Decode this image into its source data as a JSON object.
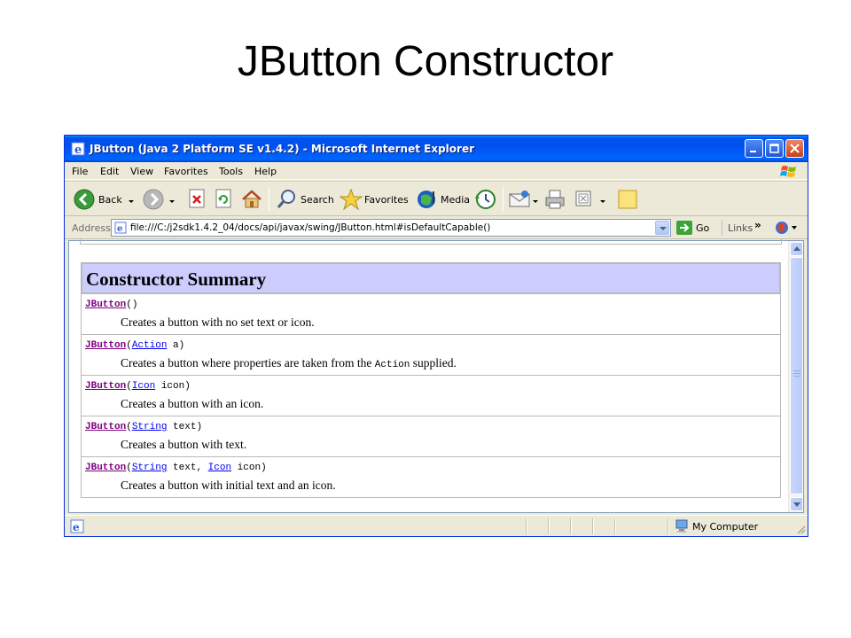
{
  "slide": {
    "title": "JButton Constructor"
  },
  "window": {
    "title": "JButton (Java 2 Platform SE v1.4.2) - Microsoft Internet Explorer"
  },
  "menu": [
    "File",
    "Edit",
    "View",
    "Favorites",
    "Tools",
    "Help"
  ],
  "toolbar": {
    "back_label": "Back",
    "search_label": "Search",
    "favorites_label": "Favorites",
    "media_label": "Media"
  },
  "address": {
    "label": "Address",
    "url": "file:///C:/j2sdk1.4.2_04/docs/api/javax/swing/JButton.html#isDefaultCapable()",
    "go_label": "Go",
    "links_label": "Links",
    "links_chevron": "»"
  },
  "summary": {
    "header": "Constructor Summary",
    "rows": [
      {
        "sig": [
          {
            "text": "JButton",
            "kind": "method"
          },
          {
            "text": "()",
            "kind": "plain"
          }
        ],
        "desc": [
          {
            "text": "Creates a button with no set text or icon.",
            "kind": "text"
          }
        ]
      },
      {
        "sig": [
          {
            "text": "JButton",
            "kind": "method"
          },
          {
            "text": "(",
            "kind": "plain"
          },
          {
            "text": "Action",
            "kind": "type"
          },
          {
            "text": " a)",
            "kind": "plain"
          }
        ],
        "desc": [
          {
            "text": "Creates a button where properties are taken from the ",
            "kind": "text"
          },
          {
            "text": "Action",
            "kind": "code"
          },
          {
            "text": " supplied.",
            "kind": "text"
          }
        ]
      },
      {
        "sig": [
          {
            "text": "JButton",
            "kind": "method"
          },
          {
            "text": "(",
            "kind": "plain"
          },
          {
            "text": "Icon",
            "kind": "type"
          },
          {
            "text": " icon)",
            "kind": "plain"
          }
        ],
        "desc": [
          {
            "text": "Creates a button with an icon.",
            "kind": "text"
          }
        ]
      },
      {
        "sig": [
          {
            "text": "JButton",
            "kind": "method"
          },
          {
            "text": "(",
            "kind": "plain"
          },
          {
            "text": "String",
            "kind": "type"
          },
          {
            "text": " text)",
            "kind": "plain"
          }
        ],
        "desc": [
          {
            "text": "Creates a button with text.",
            "kind": "text"
          }
        ]
      },
      {
        "sig": [
          {
            "text": "JButton",
            "kind": "method"
          },
          {
            "text": "(",
            "kind": "plain"
          },
          {
            "text": "String",
            "kind": "type"
          },
          {
            "text": " text, ",
            "kind": "plain"
          },
          {
            "text": "Icon",
            "kind": "type"
          },
          {
            "text": " icon)",
            "kind": "plain"
          }
        ],
        "desc": [
          {
            "text": "Creates a button with initial text and an icon.",
            "kind": "text"
          }
        ]
      }
    ]
  },
  "status": {
    "zone_label": "My Computer"
  },
  "colors": {
    "titlebar": "#0053ee",
    "table_header": "#ccccff",
    "method_link": "#800080",
    "type_link": "#0000ee"
  },
  "icons": [
    "ie-icon",
    "minimize-icon",
    "maximize-icon",
    "close-icon",
    "windows-logo-icon",
    "back-icon",
    "forward-icon",
    "stop-icon",
    "refresh-icon",
    "home-icon",
    "search-icon",
    "favorites-icon",
    "media-icon",
    "history-icon",
    "mail-icon",
    "print-icon",
    "edit-icon",
    "folder-icon",
    "page-icon",
    "go-icon",
    "tools-icon",
    "computer-icon"
  ]
}
